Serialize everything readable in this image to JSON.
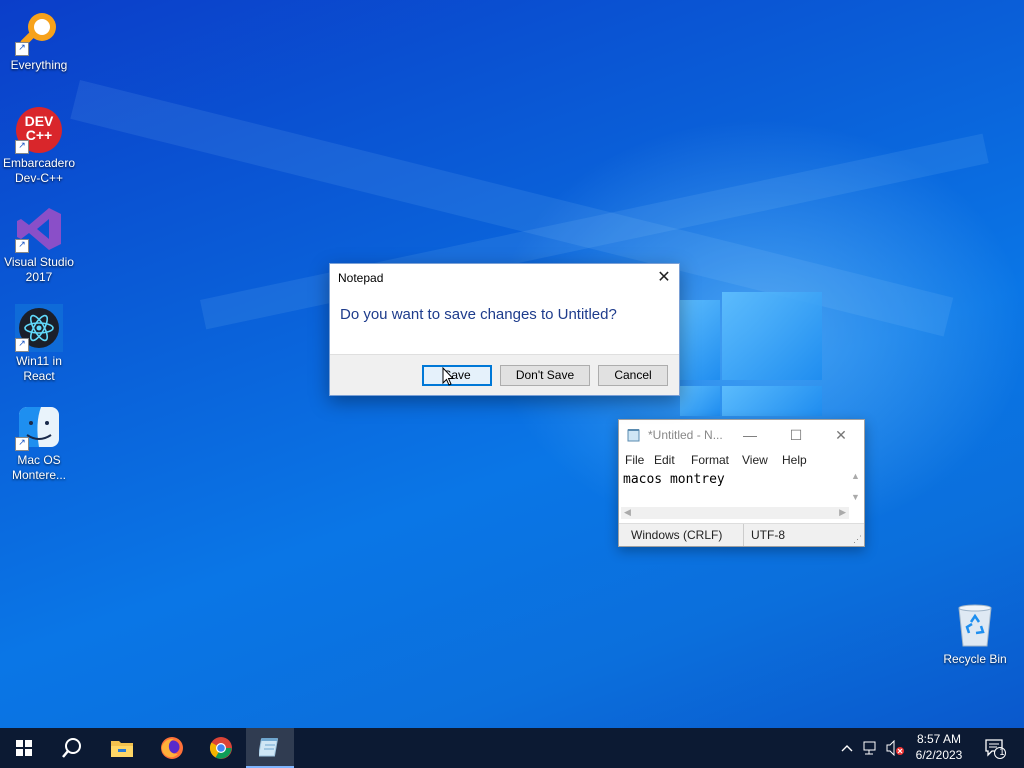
{
  "desktop": {
    "icons": [
      {
        "label_lines": [
          "Everything"
        ],
        "icon": "everything-search-icon"
      },
      {
        "label_lines": [
          "Embarcadero",
          "Dev-C++"
        ],
        "icon": "devcpp-icon",
        "badge_top": "DEV",
        "badge_bottom": "C++"
      },
      {
        "label_lines": [
          "Visual Studio",
          "2017"
        ],
        "icon": "visual-studio-icon"
      },
      {
        "label_lines": [
          "Win11 in",
          "React"
        ],
        "icon": "react-icon"
      },
      {
        "label_lines": [
          "Mac OS",
          "Montere..."
        ],
        "icon": "finder-icon"
      }
    ],
    "recycle_bin": {
      "label": "Recycle Bin",
      "icon": "recycle-bin-icon"
    }
  },
  "dialog": {
    "title": "Notepad",
    "message": "Do you want to save changes to Untitled?",
    "buttons": {
      "save": "Save",
      "dont_save": "Don't Save",
      "cancel": "Cancel"
    },
    "close_glyph": "✕"
  },
  "notepad": {
    "title": "*Untitled - N...",
    "menu": [
      "File",
      "Edit",
      "Format",
      "View",
      "Help"
    ],
    "content": "macos montrey",
    "status": {
      "line_ending": "Windows (CRLF)",
      "encoding": "UTF-8"
    }
  },
  "taskbar": {
    "pinned": [
      "start-icon",
      "search-icon",
      "file-explorer-icon",
      "firefox-icon",
      "chrome-icon",
      "notepad-icon"
    ],
    "active_app": "notepad-icon",
    "clock": {
      "time": "8:57 AM",
      "date": "6/2/2023"
    },
    "notification_count": "1"
  },
  "colors": {
    "taskbar_bg": "#0c1a33",
    "accent": "#0078d7",
    "dialog_message": "#1e3c8c"
  }
}
